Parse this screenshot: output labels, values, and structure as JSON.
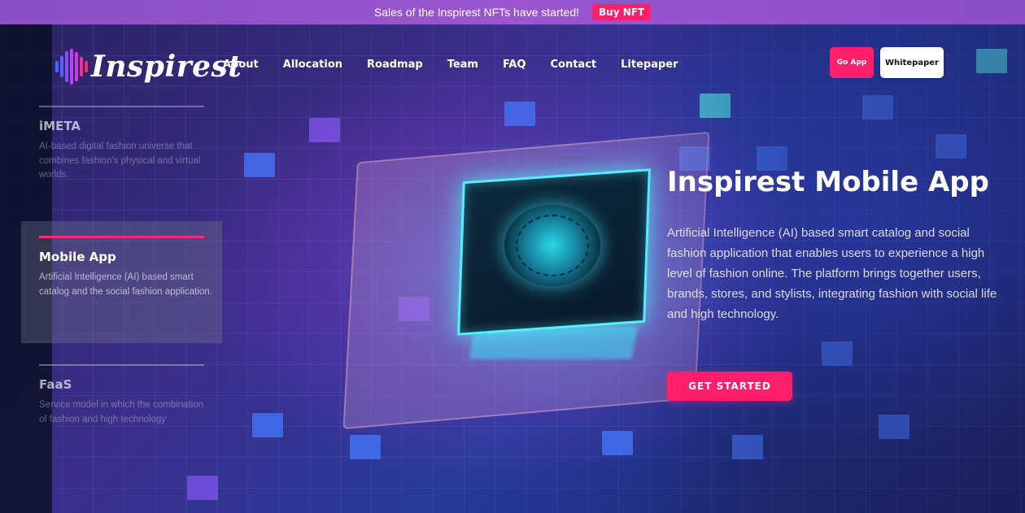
{
  "announcement": {
    "text": "Sales of the Inspirest NFTs have started!",
    "button_label": "Buy NFT"
  },
  "brand": {
    "name": "Inspirest",
    "logo_icon": "sound-wave-logo-icon"
  },
  "nav": {
    "items": [
      {
        "label": "About"
      },
      {
        "label": "Allocation"
      },
      {
        "label": "Roadmap"
      },
      {
        "label": "Team"
      },
      {
        "label": "FAQ"
      },
      {
        "label": "Contact"
      },
      {
        "label": "Litepaper"
      }
    ]
  },
  "header_buttons": {
    "go_app": "Go App",
    "whitepaper": "Whitepaper"
  },
  "features": [
    {
      "title": "iMETA",
      "description": "AI-based digital fashion universe that combines fashion's physical and virtual worlds.",
      "active": false
    },
    {
      "title": "Mobile App",
      "description": "Artificial Intelligence (AI) based smart catalog and the social fashion application.",
      "active": true
    },
    {
      "title": "FaaS",
      "description": "Service model in which the combination of fashion and high technology",
      "active": false
    }
  ],
  "hero": {
    "title": "Inspirest Mobile App",
    "description": "Artificial Intelligence (AI) based smart catalog and social fashion application that enables users to experience a high level of fashion online. The platform brings together users, brands, stores, and stylists, integrating fashion with social life and high technology.",
    "cta_label": "GET STARTED"
  },
  "colors": {
    "accent": "#ff1f6a",
    "announcement_bg": "#9a55cf",
    "active_rule": "#ff2a6e"
  }
}
